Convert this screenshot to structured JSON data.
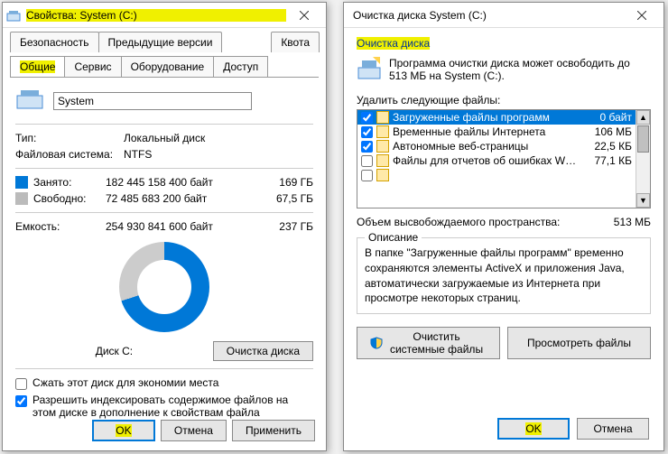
{
  "dlg1": {
    "title": "Свойства: System (C:)",
    "tabs_top": [
      "Безопасность",
      "Предыдущие версии",
      "Квота"
    ],
    "tabs_bot": [
      "Общие",
      "Сервис",
      "Оборудование",
      "Доступ"
    ],
    "volname": "System",
    "type_k": "Тип:",
    "type_v": "Локальный диск",
    "fs_k": "Файловая система:",
    "fs_v": "NTFS",
    "used_k": "Занято:",
    "used_b": "182 445 158 400 байт",
    "used_g": "169 ГБ",
    "free_k": "Свободно:",
    "free_b": "72 485 683 200 байт",
    "free_g": "67,5 ГБ",
    "cap_k": "Емкость:",
    "cap_b": "254 930 841 600 байт",
    "cap_g": "237 ГБ",
    "disklabel": "Диск C:",
    "cleanup_btn": "Очистка диска",
    "compress": "Сжать этот диск для экономии места",
    "index": "Разрешить индексировать содержимое файлов на этом диске в дополнение к свойствам файла",
    "ok": "OK",
    "cancel": "Отмена",
    "apply": "Применить"
  },
  "dlg2": {
    "title": "Очистка диска System (C:)",
    "section": "Очистка диска",
    "desc": "Программа очистки диска может освободить до 513 МБ на System (C:).",
    "list_label": "Удалить следующие файлы:",
    "items": [
      {
        "name": "Загруженные файлы программ",
        "size": "0 байт",
        "checked": true,
        "selected": true
      },
      {
        "name": "Временные файлы Интернета",
        "size": "106 МБ",
        "checked": true
      },
      {
        "name": "Автономные веб-страницы",
        "size": "22,5 КБ",
        "checked": true
      },
      {
        "name": "Файлы для отчетов об ошибках Win...",
        "size": "77,1 КБ",
        "checked": false
      }
    ],
    "freed_k": "Объем высвобождаемого пространства:",
    "freed_v": "513 МБ",
    "group_legend": "Описание",
    "group_text": "В папке \"Загруженные файлы программ\" временно сохраняются элементы ActiveX и приложения Java, автоматически загружаемые из Интернета при просмотре некоторых страниц.",
    "clean_sys": "Очистить системные файлы",
    "view_files": "Просмотреть файлы",
    "ok": "OK",
    "cancel": "Отмена"
  }
}
